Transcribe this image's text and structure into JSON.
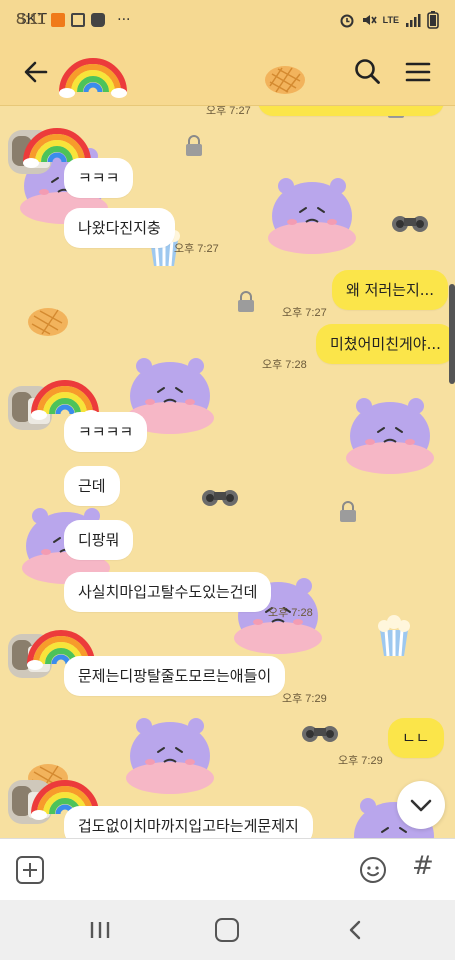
{
  "status_bar": {
    "carrier": "SKT",
    "time": "8:11",
    "dots": "···",
    "network": "LTE"
  },
  "header": {
    "back_icon": "arrow-left-icon",
    "search_icon": "search-icon",
    "menu_icon": "hamburger-menu-icon"
  },
  "messages": [
    {
      "side": "them",
      "text": "ㅋㅋㅋ"
    },
    {
      "side": "them",
      "text": "나왔다진지충",
      "time": "오후 7:27"
    },
    {
      "side": "me",
      "text": "왜 저러는지...",
      "time": "오후 7:27"
    },
    {
      "side": "me",
      "text": "미쳤어미친게야...",
      "time": "오후 7:28"
    },
    {
      "side": "them",
      "text": "ㅋㅋㅋㅋ"
    },
    {
      "side": "them",
      "text": "근데"
    },
    {
      "side": "them",
      "text": "디팡뭐"
    },
    {
      "side": "them",
      "text": "사실치마입고탈수도있는건데",
      "time": "오후 7:28"
    },
    {
      "side": "them",
      "text": "문제는디팡탈줄도모르는애들이",
      "time": "오후 7:29"
    },
    {
      "side": "me",
      "text": "ㄴㄴ",
      "time": "오후 7:29"
    },
    {
      "side": "them",
      "text": "겁도없이치마까지입고타는게문제지"
    }
  ],
  "top_partial_time": "오후 7:27",
  "input_bar": {
    "plus_icon": "plus-icon",
    "emoji_icon": "emoji-icon",
    "hash_label": "#"
  },
  "nav_bar": {
    "recent_icon": "recent-apps-icon",
    "home_icon": "home-icon",
    "back_icon": "back-chevron-icon"
  },
  "colors": {
    "chat_bg": "#f7e0a0",
    "my_bubble": "#fbe54a",
    "their_bubble": "#ffffff",
    "hippo": "#b9a6ec",
    "hippo_pink": "#f6b7c6"
  }
}
